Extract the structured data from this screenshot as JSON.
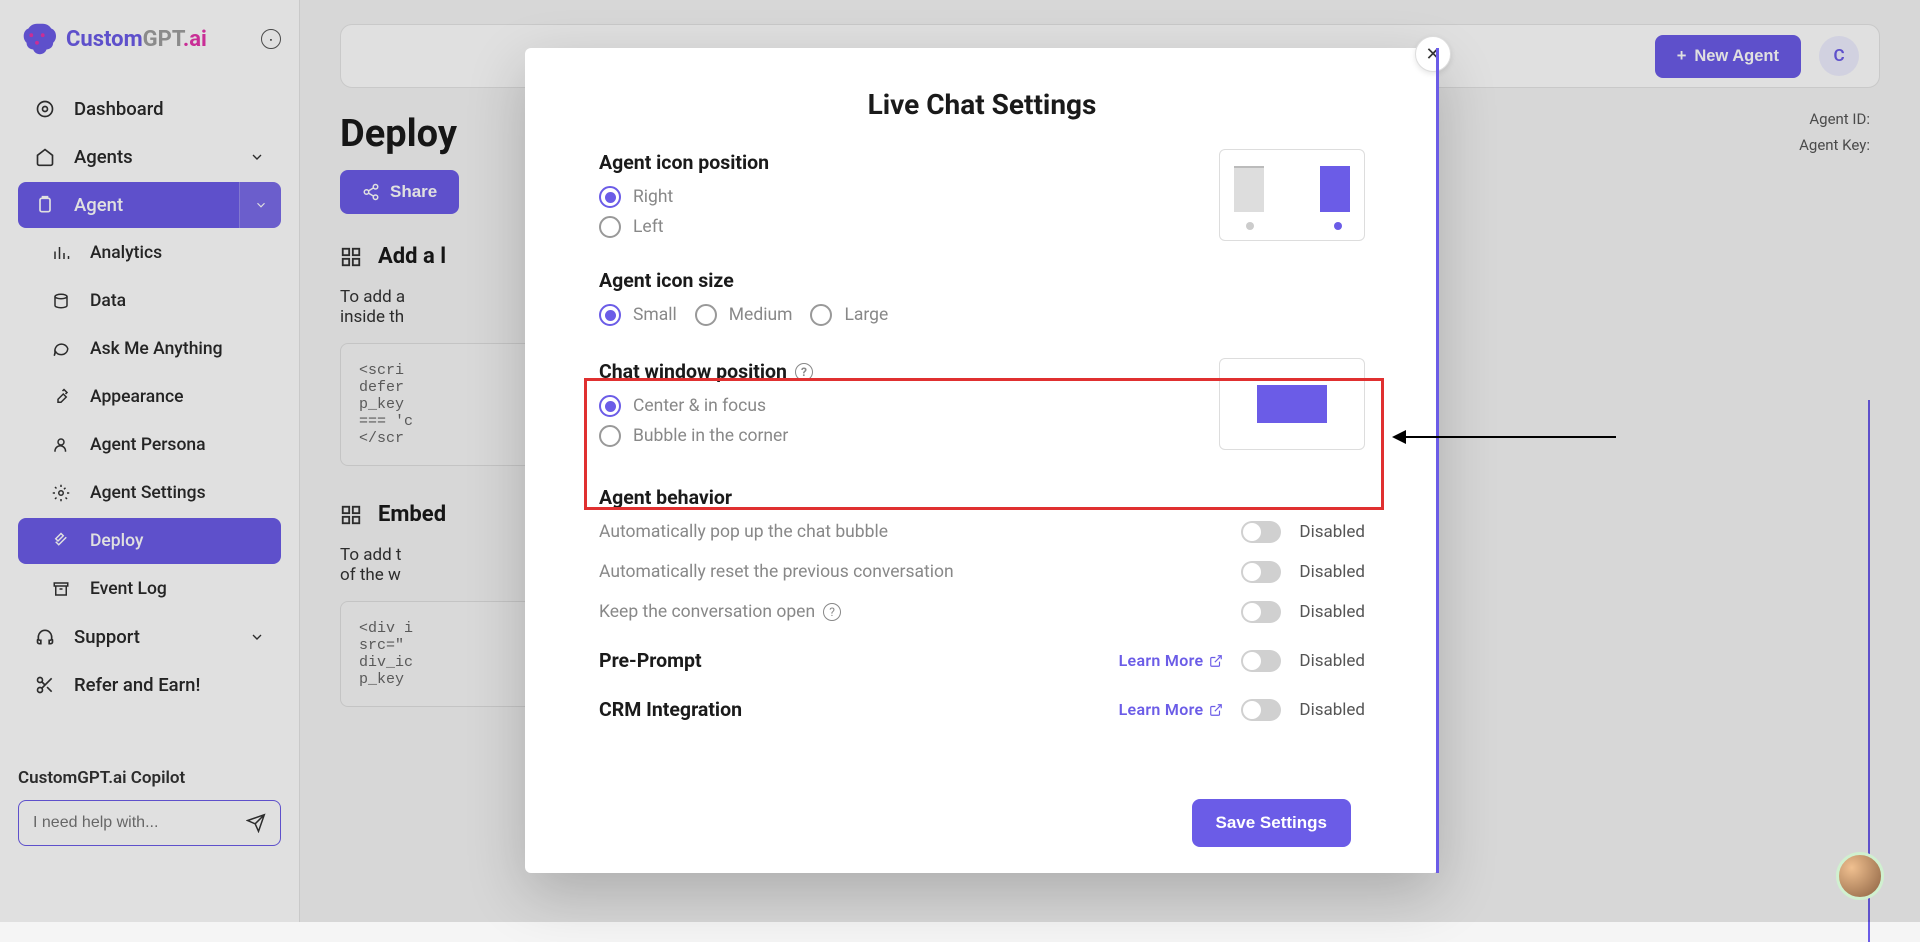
{
  "brand": {
    "part1": "Custom",
    "part2": "GPT",
    "part3": ".ai"
  },
  "sidebar": {
    "dashboard": "Dashboard",
    "agents": "Agents",
    "agent": "Agent",
    "analytics": "Analytics",
    "data": "Data",
    "ask": "Ask Me Anything",
    "appearance": "Appearance",
    "persona": "Agent Persona",
    "settings": "Agent Settings",
    "deploy": "Deploy",
    "eventlog": "Event Log",
    "support": "Support",
    "refer": "Refer and Earn!",
    "copilot_label": "CustomGPT.ai Copilot",
    "copilot_placeholder": "I need help with..."
  },
  "header": {
    "new_agent": "New Agent",
    "avatar_letter": "C",
    "agent_id_label": "Agent ID:",
    "agent_key_label": "Agent Key:"
  },
  "page": {
    "title": "Deploy",
    "share": "Share",
    "add_section": "Add a l",
    "add_desc": "To add a\ninside th",
    "add_code": "<scri\ndefer\np_key\n=== 'c\n</scr",
    "embed_section": "Embed",
    "embed_desc": "To add t\nof the w",
    "embed_code": "<div i\nsrc=\"\ndiv_ic\np_key"
  },
  "modal": {
    "title": "Live Chat Settings",
    "icon_position": {
      "label": "Agent icon position",
      "right": "Right",
      "left": "Left",
      "selected": "right"
    },
    "icon_size": {
      "label": "Agent icon size",
      "small": "Small",
      "medium": "Medium",
      "large": "Large",
      "selected": "small"
    },
    "chat_window": {
      "label": "Chat window position",
      "center": "Center & in focus",
      "bubble": "Bubble in the corner",
      "selected": "center"
    },
    "behavior": {
      "label": "Agent behavior",
      "auto_popup": "Automatically pop up the chat bubble",
      "auto_reset": "Automatically reset the previous conversation",
      "keep_open": "Keep the conversation open",
      "disabled": "Disabled"
    },
    "pre_prompt": {
      "label": "Pre-Prompt",
      "learn_more": "Learn More",
      "state": "Disabled"
    },
    "crm": {
      "label": "CRM Integration",
      "learn_more": "Learn More",
      "state": "Disabled"
    },
    "save": "Save Settings"
  }
}
